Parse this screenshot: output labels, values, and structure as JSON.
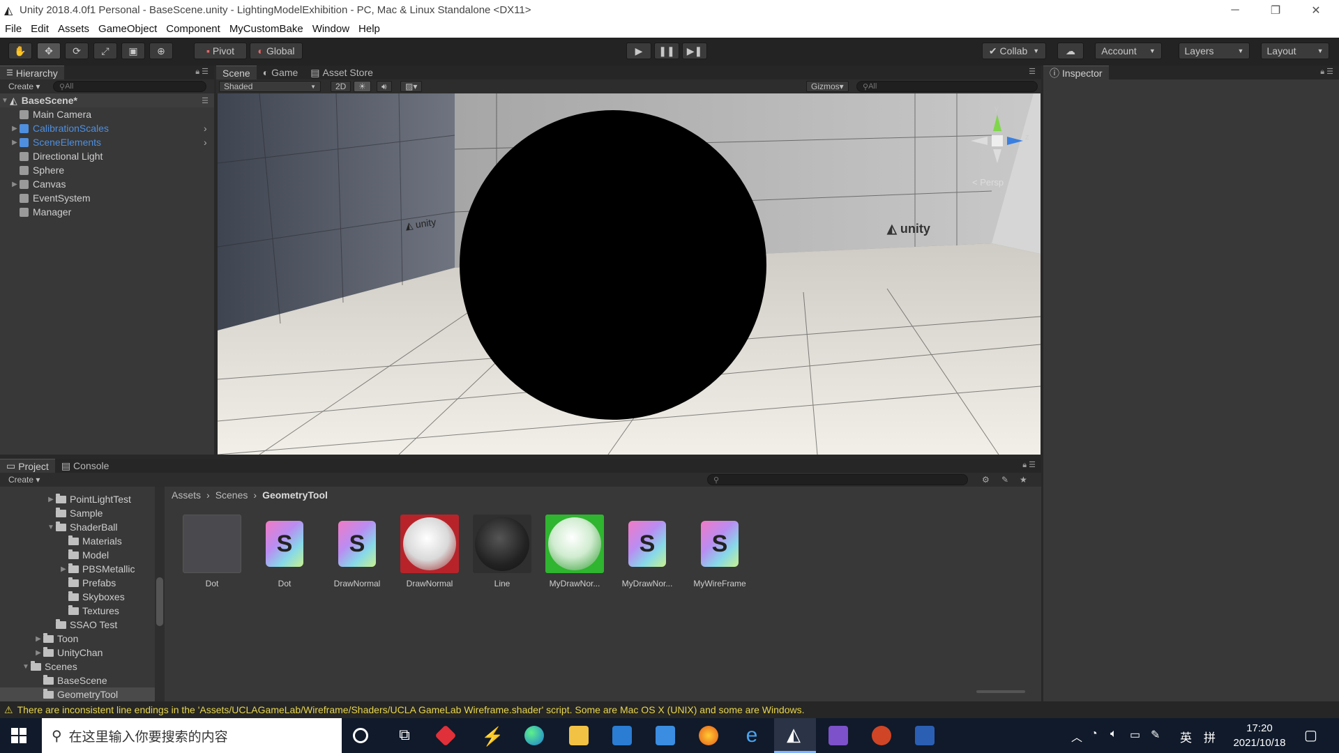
{
  "window": {
    "title": "Unity 2018.4.0f1 Personal - BaseScene.unity - LightingModelExhibition - PC, Mac & Linux Standalone <DX11>",
    "min": "─",
    "max": "❐",
    "close": "✕"
  },
  "menu": [
    "File",
    "Edit",
    "Assets",
    "GameObject",
    "Component",
    "MyCustomBake",
    "Window",
    "Help"
  ],
  "toolbar": {
    "pivot": "Pivot",
    "global": "Global",
    "collab": "Collab",
    "account": "Account",
    "layers": "Layers",
    "layout": "Layout"
  },
  "hierarchy": {
    "tab": "Hierarchy",
    "create": "Create",
    "search_placeholder": "All",
    "scene": "BaseScene*",
    "items": [
      {
        "label": "Main Camera",
        "expandable": false,
        "prefab": false
      },
      {
        "label": "CalibrationScales",
        "expandable": true,
        "prefab": true
      },
      {
        "label": "SceneElements",
        "expandable": true,
        "prefab": true
      },
      {
        "label": "Directional Light",
        "expandable": false,
        "prefab": false
      },
      {
        "label": "Sphere",
        "expandable": false,
        "prefab": false
      },
      {
        "label": "Canvas",
        "expandable": true,
        "prefab": false
      },
      {
        "label": "EventSystem",
        "expandable": false,
        "prefab": false
      },
      {
        "label": "Manager",
        "expandable": false,
        "prefab": false
      }
    ]
  },
  "scene_tabs": [
    "Scene",
    "Game",
    "Asset Store"
  ],
  "scene_toolbar": {
    "shaded": "Shaded",
    "mode_2d": "2D",
    "gizmos": "Gizmos",
    "search_placeholder": "All",
    "persp": "< Persp"
  },
  "inspector": {
    "tab": "Inspector"
  },
  "project": {
    "tabs": [
      "Project",
      "Console"
    ],
    "create": "Create",
    "tree": [
      {
        "label": "PointLightTest",
        "depth": 3,
        "expandable": true
      },
      {
        "label": "Sample",
        "depth": 3,
        "expandable": false
      },
      {
        "label": "ShaderBall",
        "depth": 3,
        "expandable": true,
        "open": true
      },
      {
        "label": "Materials",
        "depth": 4,
        "expandable": false
      },
      {
        "label": "Model",
        "depth": 4,
        "expandable": false
      },
      {
        "label": "PBSMetallic",
        "depth": 4,
        "expandable": true
      },
      {
        "label": "Prefabs",
        "depth": 4,
        "expandable": false
      },
      {
        "label": "Skyboxes",
        "depth": 4,
        "expandable": false
      },
      {
        "label": "Textures",
        "depth": 4,
        "expandable": false
      },
      {
        "label": "SSAO Test",
        "depth": 3,
        "expandable": false
      },
      {
        "label": "Toon",
        "depth": 2,
        "expandable": true
      },
      {
        "label": "UnityChan",
        "depth": 2,
        "expandable": true
      },
      {
        "label": "Scenes",
        "depth": 1,
        "expandable": true,
        "open": true
      },
      {
        "label": "BaseScene",
        "depth": 2,
        "expandable": false
      },
      {
        "label": "GeometryTool",
        "depth": 2,
        "expandable": false,
        "selected": true
      }
    ],
    "breadcrumb": [
      "Assets",
      "Scenes",
      "GeometryTool"
    ],
    "assets": [
      {
        "label": "Dot",
        "kind": "scene-thumb"
      },
      {
        "label": "Dot",
        "kind": "shader"
      },
      {
        "label": "DrawNormal",
        "kind": "shader"
      },
      {
        "label": "DrawNormal",
        "kind": "material-red"
      },
      {
        "label": "Line",
        "kind": "material-dark"
      },
      {
        "label": "MyDrawNor...",
        "kind": "material-green"
      },
      {
        "label": "MyDrawNor...",
        "kind": "shader"
      },
      {
        "label": "MyWireFrame",
        "kind": "shader"
      }
    ]
  },
  "status": {
    "message": "There are inconsistent line endings in the 'Assets/UCLAGameLab/Wireframe/Shaders/UCLA GameLab Wireframe.shader' script. Some are Mac OS X (UNIX) and some are Windows."
  },
  "taskbar": {
    "search_placeholder": "在这里输入你要搜索的内容",
    "ime": "英",
    "ime2": "拼",
    "time": "17:20",
    "date": "2021/10/18"
  }
}
